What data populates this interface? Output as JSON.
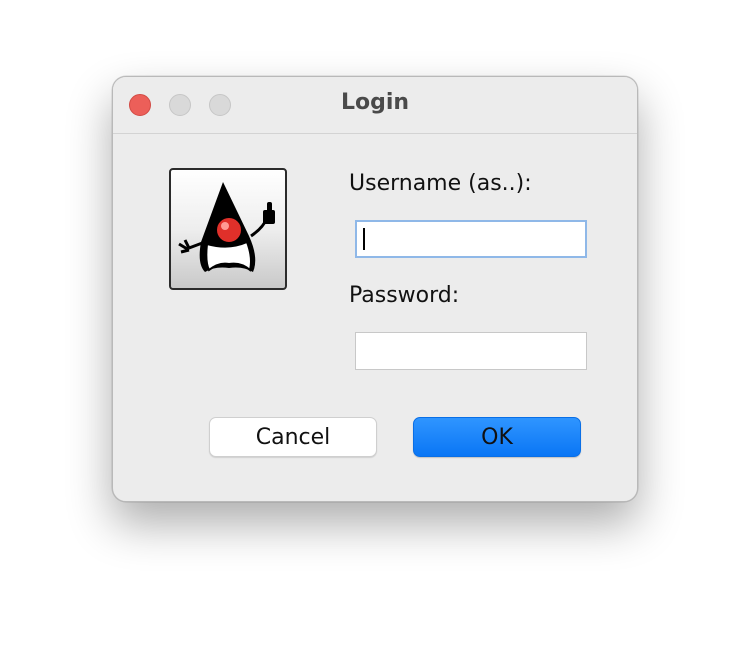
{
  "window": {
    "title": "Login"
  },
  "form": {
    "username_label": "Username (as..):",
    "username_value": "",
    "password_label": "Password:",
    "password_value": ""
  },
  "buttons": {
    "cancel_label": "Cancel",
    "ok_label": "OK"
  },
  "logo": {
    "icon": "java-duke-logo"
  },
  "colors": {
    "close_button": "#ec5f59",
    "ok_button": "#0a76f5",
    "focus_ring": "#8fb8e8"
  }
}
